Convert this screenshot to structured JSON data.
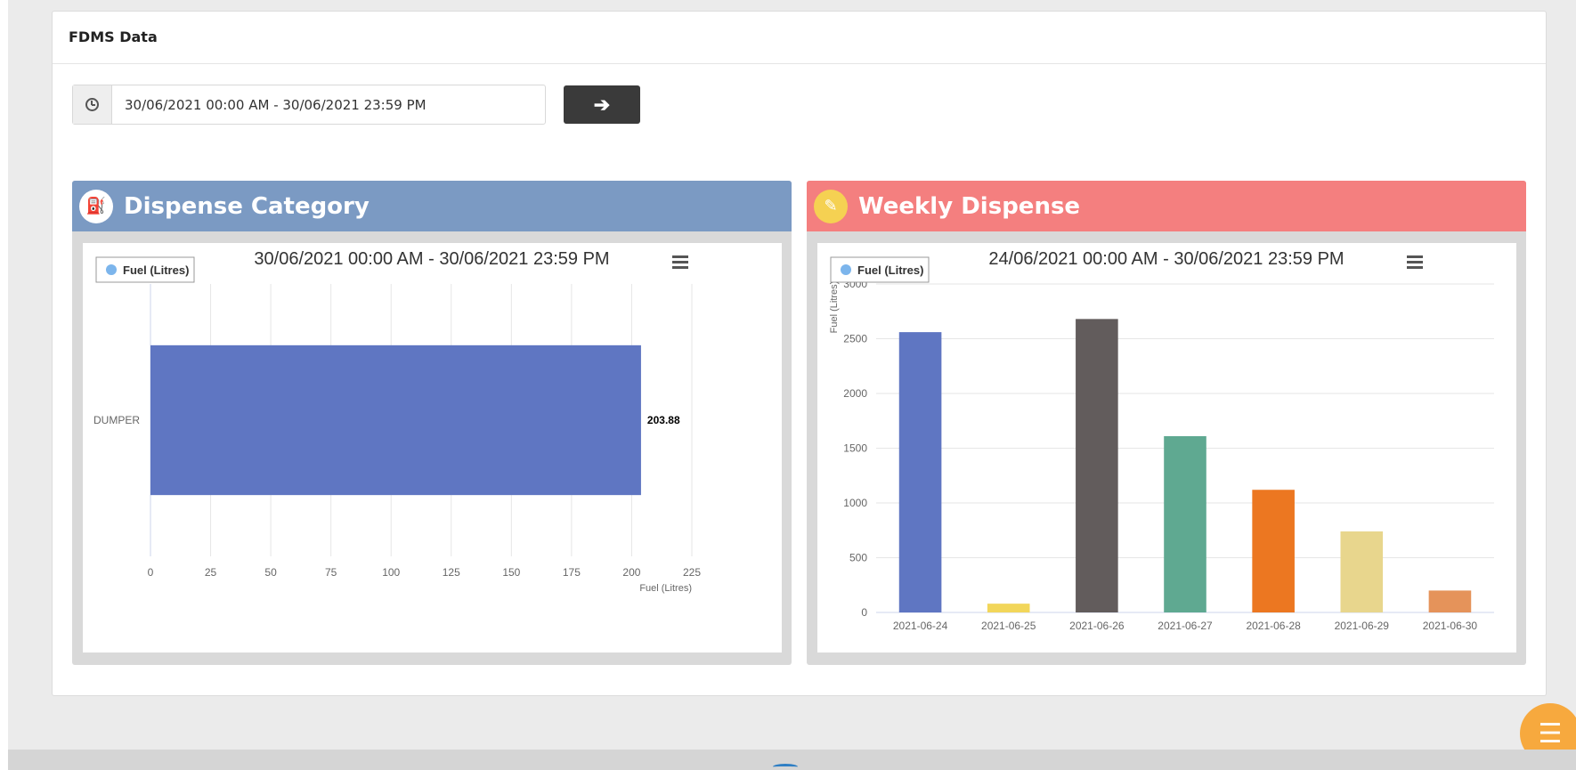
{
  "card": {
    "title": "FDMS Data"
  },
  "date_range": {
    "value": "30/06/2021 00:00 AM - 30/06/2021 23:59 PM"
  },
  "go_button": {
    "icon": "arrow-right-icon"
  },
  "panels": {
    "left": {
      "title": "Dispense Category",
      "icon": "fuel-pump-icon",
      "color": "#7b9ac3"
    },
    "right": {
      "title": "Weekly Dispense",
      "icon": "edit-icon",
      "color": "#f47f7f"
    }
  },
  "fab": {
    "icon": "menu-icon",
    "color": "#f7a93e"
  },
  "chart_data": [
    {
      "type": "bar",
      "orientation": "horizontal",
      "title": "30/06/2021 00:00 AM - 30/06/2021 23:59 PM",
      "categories": [
        "DUMPER"
      ],
      "series": [
        {
          "name": "Fuel (Litres)",
          "values": [
            203.88
          ],
          "color": "#5f76c2"
        }
      ],
      "data_labels": [
        "203.88"
      ],
      "xlabel": "Fuel (Litres)",
      "ylabel": "",
      "xlim": [
        0,
        225
      ],
      "xticks": [
        0,
        25,
        50,
        75,
        100,
        125,
        150,
        175,
        200,
        225
      ],
      "grid": true,
      "legend": "top-left",
      "legend_marker_color": "#7cb5ec"
    },
    {
      "type": "bar",
      "title": "24/06/2021 00:00 AM - 30/06/2021 23:59 PM",
      "categories": [
        "2021-06-24",
        "2021-06-25",
        "2021-06-26",
        "2021-06-27",
        "2021-06-28",
        "2021-06-29",
        "2021-06-30"
      ],
      "series": [
        {
          "name": "Fuel (Litres)",
          "values": [
            2560,
            80,
            2680,
            1610,
            1120,
            740,
            200
          ]
        }
      ],
      "bar_colors": [
        "#5f76c2",
        "#f2d65a",
        "#625c5c",
        "#5fa991",
        "#ec7721",
        "#e8d68d",
        "#e5935a"
      ],
      "xlabel": "",
      "ylabel": "Fuel (Litres)",
      "ylim": [
        0,
        3000
      ],
      "yticks": [
        0,
        500,
        1000,
        1500,
        2000,
        2500,
        3000
      ],
      "grid": true,
      "legend": "top-left",
      "legend_marker_color": "#7cb5ec"
    }
  ]
}
